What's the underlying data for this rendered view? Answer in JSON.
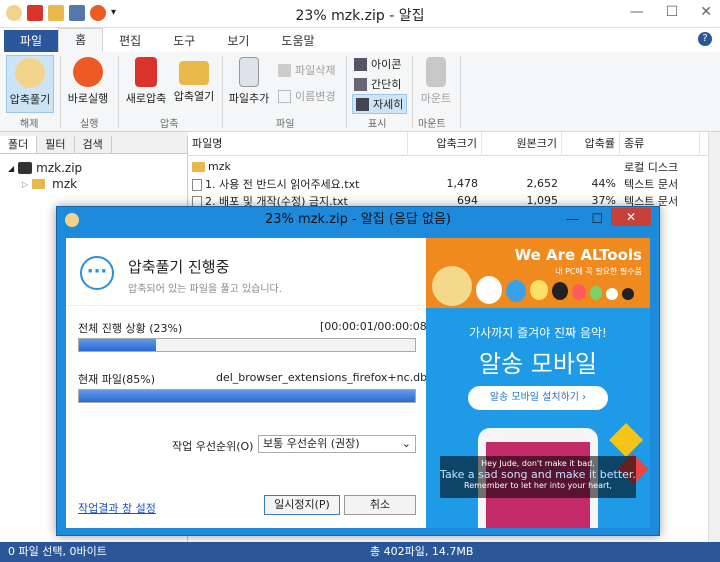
{
  "window": {
    "title": "23% mzk.zip - 알집"
  },
  "ribbon_tabs": [
    "파일",
    "홈",
    "편집",
    "도구",
    "보기",
    "도움말"
  ],
  "ribbon": {
    "extract": "압축풀기",
    "extract_group": "해제",
    "run": "바로실행",
    "run_group": "실행",
    "new_zip": "새로압축",
    "open_zip": "압축열기",
    "zip_group": "압축",
    "add_file": "파일추가",
    "delete_file": "파일삭제",
    "rename": "이름변경",
    "file_group": "파일",
    "view_icon": "아이콘",
    "view_simple": "간단히",
    "view_detail": "자세히",
    "view_group": "표시",
    "mount": "마운트",
    "mount_group": "마운트"
  },
  "left_pane": {
    "tabs": [
      "폴더",
      "필터",
      "검색"
    ],
    "tree": {
      "root": "mzk.zip",
      "child": "mzk"
    }
  },
  "table": {
    "headers": [
      "파일명",
      "압축크기",
      "원본크기",
      "압축률",
      "종류"
    ],
    "rows": [
      {
        "name": "mzk",
        "packed": "",
        "original": "",
        "ratio": "",
        "type": "로컬 디스크",
        "folder": true
      },
      {
        "name": "1. 사용 전 반드시 읽어주세요.txt",
        "packed": "1,478",
        "original": "2,652",
        "ratio": "44%",
        "type": "텍스트 문서",
        "folder": false
      },
      {
        "name": "2. 배포 및 개작(수정) 금지.txt",
        "packed": "694",
        "original": "1,095",
        "ratio": "37%",
        "type": "텍스트 문서",
        "folder": false
      }
    ]
  },
  "statusbar": {
    "left": "0 파일 선택, 0바이트",
    "right": "총 402파일, 14.7MB"
  },
  "dialog": {
    "title": "23% mzk.zip - 알집 (응답 없음)",
    "heading": "압축풀기 진행중",
    "subtext": "압축되어 있는 파일을 풀고 있습니다.",
    "overall_label": "전체 진행 상황 (23%)",
    "overall_time": "[00:00:01/00:00:08]",
    "overall_progress": 0.23,
    "current_label": "현재 파일(85%)",
    "current_file": "del_browser_extensions_firefox+nc.db",
    "current_progress": 1.0,
    "priority_label": "작업 우선순위(O)",
    "priority_value": "보통 우선순위 (권장)",
    "result_link": "작업결과 창 설정",
    "pause_button": "일시정지(P)",
    "cancel_button": "취소",
    "close_glyph": "✕"
  },
  "ad": {
    "brand": "We Are ALTools",
    "tagline": "내 PC에 꼭 필요한 필수품",
    "script": "가사까지 즐겨야 진짜 음악!",
    "big": "알송 모바일",
    "cta": "알송 모바일 설치하기 ›",
    "lyric1": "Hey Jude, don't make it bad.",
    "lyric2": "Take a sad song and make it better.",
    "lyric3": "Remember to let her into your heart,"
  },
  "colors": {
    "accent": "#2b579a",
    "dialog_frame": "#1e8adb",
    "progress": "#2c6bd2"
  }
}
